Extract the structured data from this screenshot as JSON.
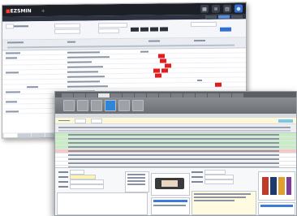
{
  "back_window": {
    "logo_text": "EZSMIN",
    "add_icon": "plus-icon",
    "nav_icons": [
      "grid-icon",
      "list-icon",
      "document-icon",
      "person-icon"
    ]
  },
  "front_window": {
    "toolbar_icons": [
      "new-icon",
      "save-icon",
      "delete-icon",
      "search-icon",
      "print-icon",
      "export-icon"
    ]
  },
  "colors": {
    "dark_header": "#1c1f26",
    "accent_blue": "#2f6fd6",
    "alert_red": "#e51c1c",
    "row_green": "#c8ecc4",
    "row_red": "#f3c9c9",
    "info_yellow": "#fdf7da"
  }
}
